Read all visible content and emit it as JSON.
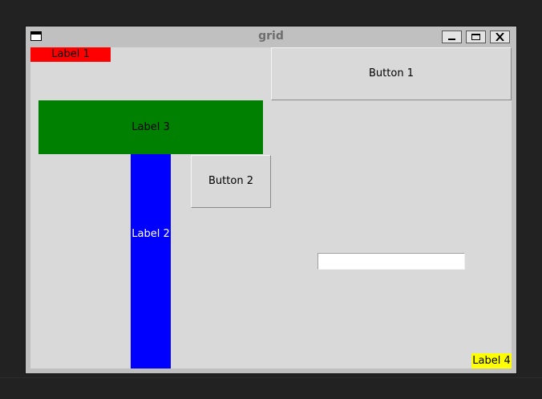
{
  "window": {
    "title": "grid",
    "icon": "window-icon",
    "controls": [
      "minimize-icon",
      "maximize-icon",
      "close-icon"
    ]
  },
  "widgets": {
    "label1": {
      "text": "Label 1",
      "bg": "#ff0000"
    },
    "label2": {
      "text": "Label 2",
      "bg": "#0000ff"
    },
    "label3": {
      "text": "Label 3",
      "bg": "#008000"
    },
    "label4": {
      "text": "Label 4",
      "bg": "#ffff00"
    },
    "button1": {
      "text": "Button 1"
    },
    "button2": {
      "text": "Button 2"
    },
    "entry": {
      "value": ""
    }
  }
}
